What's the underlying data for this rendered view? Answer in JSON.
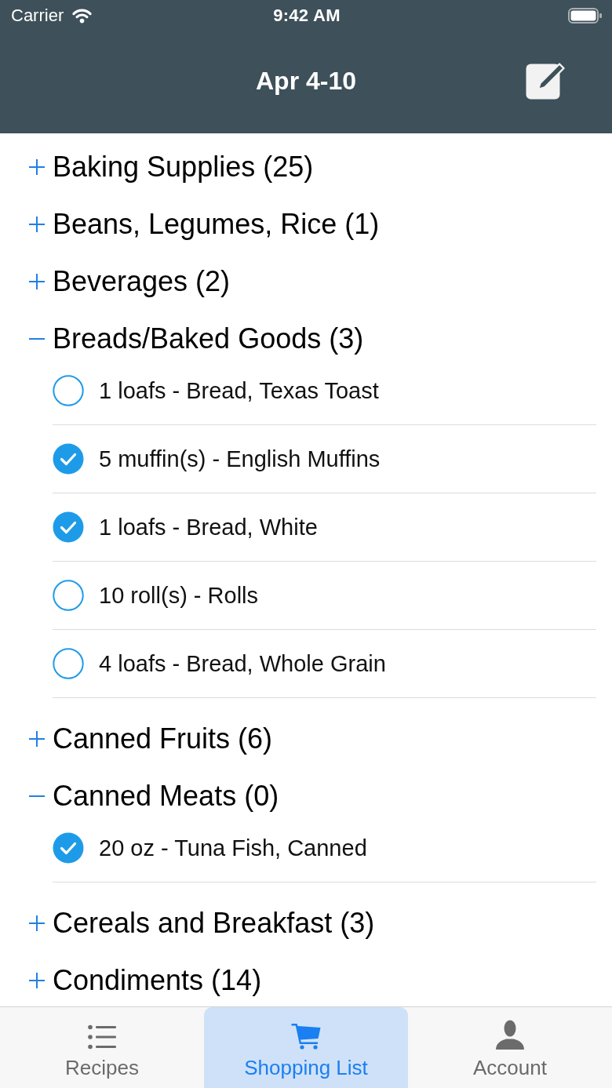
{
  "status_bar": {
    "carrier": "Carrier",
    "time": "9:42 AM"
  },
  "nav_bar": {
    "title": "Apr 4-10"
  },
  "categories": [
    {
      "label": "Baking Supplies (25)",
      "expanded": false
    },
    {
      "label": "Beans, Legumes, Rice (1)",
      "expanded": false
    },
    {
      "label": "Beverages (2)",
      "expanded": false
    },
    {
      "label": "Breads/Baked Goods (3)",
      "expanded": true,
      "items": [
        {
          "text": "1 loafs - Bread, Texas Toast",
          "checked": false
        },
        {
          "text": "5 muffin(s) - English Muffins",
          "checked": true
        },
        {
          "text": "1 loafs - Bread, White",
          "checked": true
        },
        {
          "text": "10 roll(s) - Rolls",
          "checked": false
        },
        {
          "text": "4 loafs - Bread, Whole Grain",
          "checked": false
        }
      ]
    },
    {
      "label": "Canned Fruits (6)",
      "expanded": false
    },
    {
      "label": "Canned Meats (0)",
      "expanded": true,
      "items": [
        {
          "text": "20 oz - Tuna Fish, Canned",
          "checked": true
        }
      ]
    },
    {
      "label": "Cereals and Breakfast (3)",
      "expanded": false
    },
    {
      "label": "Condiments (14)",
      "expanded": false
    }
  ],
  "tab_bar": {
    "tabs": [
      {
        "label": "Recipes",
        "kind": "list",
        "selected": false
      },
      {
        "label": "Shopping List",
        "kind": "cart",
        "selected": true
      },
      {
        "label": "Account",
        "kind": "person",
        "selected": false
      }
    ]
  }
}
